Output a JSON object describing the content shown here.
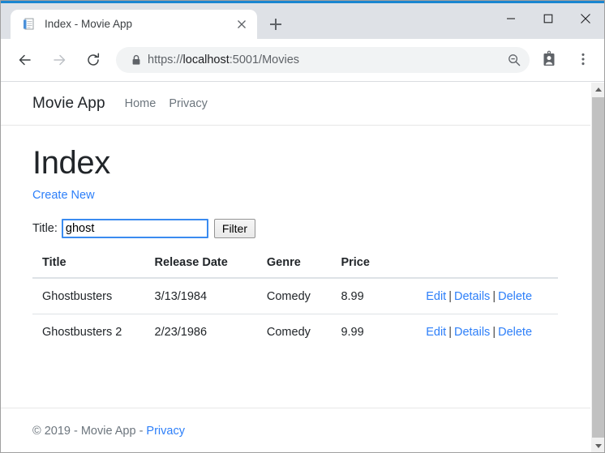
{
  "browser": {
    "tab": {
      "title": "Index - Movie App",
      "favicon_icon": "document-icon",
      "close_icon": "close-icon"
    },
    "new_tab_icon": "plus-icon",
    "window_controls": {
      "minimize_icon": "minimize-icon",
      "maximize_icon": "maximize-icon",
      "close_icon": "close-icon"
    },
    "toolbar": {
      "back_icon": "back-arrow-icon",
      "forward_icon": "forward-arrow-icon",
      "reload_icon": "reload-icon",
      "lock_icon": "lock-icon",
      "zoom_icon": "zoom-out-icon",
      "profile_icon": "profile-badge-icon",
      "menu_icon": "three-dot-menu-icon",
      "url_scheme": "https://",
      "url_host": "localhost",
      "url_rest": ":5001/Movies",
      "url_full": "https://localhost:5001/Movies"
    }
  },
  "site": {
    "brand": "Movie App",
    "nav_links": [
      {
        "label": "Home"
      },
      {
        "label": "Privacy"
      }
    ]
  },
  "main": {
    "page_title": "Index",
    "create_new_label": "Create New",
    "filter": {
      "label": "Title:",
      "value": "ghost",
      "placeholder": "",
      "button_label": "Filter"
    },
    "table": {
      "columns": [
        "Title",
        "Release Date",
        "Genre",
        "Price",
        ""
      ],
      "rows": [
        {
          "title": "Ghostbusters",
          "release_date": "3/13/1984",
          "genre": "Comedy",
          "price": "8.99",
          "actions": [
            "Edit",
            "Details",
            "Delete"
          ]
        },
        {
          "title": "Ghostbusters 2",
          "release_date": "2/23/1986",
          "genre": "Comedy",
          "price": "9.99",
          "actions": [
            "Edit",
            "Details",
            "Delete"
          ]
        }
      ],
      "action_separator": "|"
    }
  },
  "footer": {
    "text": "© 2019 - Movie App -",
    "link_label": "Privacy"
  },
  "scrollbar": {
    "up_icon": "triangle-up-icon",
    "down_icon": "triangle-down-icon"
  },
  "colors": {
    "accent_blue": "#1a86d0",
    "link_blue": "#2d7ff9",
    "tabstrip_gray": "#dee1e6",
    "omnibox_gray": "#f1f3f4",
    "text_dark": "#212529",
    "text_muted": "#6c757d",
    "focus_border": "#3a8bf0"
  }
}
